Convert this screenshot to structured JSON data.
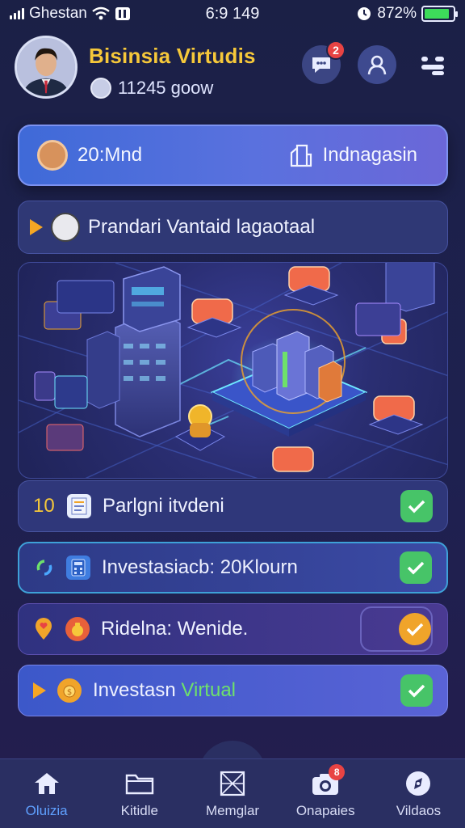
{
  "status_bar": {
    "carrier": "Ghestan",
    "time": "6:9 149",
    "battery_text": "872%",
    "battery_level": 0.87
  },
  "header": {
    "title": "Bisinsia Virtudis",
    "subtitle": "11245 goow",
    "chat_badge": "2"
  },
  "summary": {
    "left_label": "20:Mnd",
    "right_label": "Indnagasin"
  },
  "banner": {
    "label": "Prandari Vantaid lagaotaal"
  },
  "tasks": [
    {
      "number": "10",
      "label": "Parlgni itvdeni",
      "status": "done"
    },
    {
      "label": "Investasiacb: 20Klourn",
      "status": "done"
    },
    {
      "label": "Ridelna: Wenide.",
      "status": "pending"
    },
    {
      "label_prefix": "Investasn",
      "label_highlight": "Virtual",
      "status": "done"
    }
  ],
  "bottom_nav": {
    "items": [
      {
        "label": "Oluizia",
        "icon": "home-icon",
        "active": true
      },
      {
        "label": "Kitidle",
        "icon": "folder-icon"
      },
      {
        "label": "Memglar",
        "icon": "map-icon"
      },
      {
        "label": "Onapaies",
        "icon": "camera-icon",
        "badge": "8"
      },
      {
        "label": "Vildaos",
        "icon": "compass-icon"
      }
    ]
  },
  "colors": {
    "accent": "#f6c83a",
    "check_green": "#47c468",
    "check_orange": "#f0a42a",
    "nav_active": "#5fa0ff"
  }
}
